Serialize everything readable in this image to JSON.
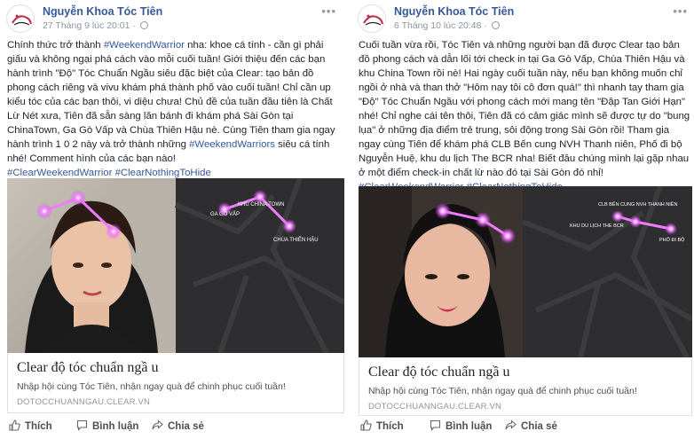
{
  "posts": [
    {
      "author": "Nguyễn Khoa Tóc Tiên",
      "timestamp": "27 Tháng 9 lúc 20:01 ·",
      "body_segments": [
        {
          "text": "Chính thức trở thành ",
          "tag": false
        },
        {
          "text": "#WeekendWarrior",
          "tag": true
        },
        {
          "text": " nha: khoe cá tính - cần gì phải giấu và không ngại phá cách vào mỗi cuối tuần! Giới thiệu đến các bạn hành trình \"Độ\" Tóc Chuẩn Ngầu siêu đặc biệt của Clear: tạo bản đồ phong cách riêng và vivu khám phá thành phố vào cuối tuần! Chỉ cần up kiểu tóc của các bạn thôi, vi diệu chưa! Chủ đề của tuần đầu tiên là Chất Lừ Nét xưa, Tiên đã sẵn sàng lăn bánh đi khám phá Sài Gòn tại ChinaTown, Ga Gò Vấp và Chùa Thiên Hậu nè. Cùng Tiên tham gia ngay hành trình 1 0 2 này và trở thành những ",
          "tag": false
        },
        {
          "text": "#WeekendWarriors",
          "tag": true
        },
        {
          "text": " siêu cá tính nhé! Comment hình của các bạn nào!",
          "tag": false
        },
        {
          "text": "\n",
          "tag": false
        },
        {
          "text": "#ClearWeekendWarrior",
          "tag": true
        },
        {
          "text": " ",
          "tag": false
        },
        {
          "text": "#ClearNothingToHide",
          "tag": true
        }
      ],
      "map_labels": [
        "GA GÒ VẤP",
        "KHU CHINA TOWN",
        "CHÙA THIÊN HẬU"
      ],
      "link_title": "Clear độ tóc chuẩn ngầ u",
      "link_desc": "Nhập hội cùng Tóc Tiên, nhận ngay quà để chinh phục cuối tuần!",
      "link_domain": "DOTOCCHUANNGAU.CLEAR.VN",
      "actions": [
        "Thích",
        "Bình luận",
        "Chia sẻ"
      ]
    },
    {
      "author": "Nguyễn Khoa Tóc Tiên",
      "timestamp": "6 Tháng 10 lúc 20:48 ·",
      "body_segments": [
        {
          "text": "Cuối tuần vừa rồi, Tóc Tiên và những người bạn đã được Clear tạo bản đồ phong cách và dẫn lối tới check in tại Ga Gò Vấp, Chùa Thiên Hậu và khu China Town rồi nè! Hai ngày cuối tuần này, nếu bạn không muốn chỉ ngồi ở nhà và than thở \"Hôm nay tôi cô đơn quá!\" thì nhanh tay tham gia \"Độ\" Tóc Chuẩn Ngầu với phong cách mới mang tên \"Đập Tan Giới Hạn\" nhé! Chỉ nghe cái tên thôi, Tiên đã có cảm giác mình sẽ được tự do \"bung lụa\" ở những địa điểm trẻ trung, sôi động trong Sài Gòn rồi! Tham gia ngay cùng Tiên để khám phá CLB Bến cung NVH Thanh niên, Phố đi bộ Nguyễn Huệ, khu du lịch The BCR nha! Biết đâu chúng mình lại gặp nhau ở một điểm check-in chất lừ nào đó tại Sài Gòn đó nhỉ!",
          "tag": false
        },
        {
          "text": "\n",
          "tag": false
        },
        {
          "text": "#ClearWeekendWarrior",
          "tag": true
        },
        {
          "text": " ",
          "tag": false
        },
        {
          "text": "#ClearNothingToHide",
          "tag": true
        }
      ],
      "map_labels": [
        "CLB BẾN CUNG NVH THANH NIÊN",
        "KHU DU LỊCH THE BCR",
        "PHỐ ĐI BỘ"
      ],
      "link_title": "Clear độ tóc chuẩn ngầ u",
      "link_desc": "Nhập hội cùng Tóc Tiên, nhận ngay quà để chinh phục cuối tuần!",
      "link_domain": "DOTOCCHUANNGAU.CLEAR.VN",
      "actions": [
        "Thích",
        "Bình luận",
        "Chia sẻ"
      ]
    }
  ],
  "colors": {
    "link_blue": "#365899",
    "meta_gray": "#90949c",
    "text": "#1d2129",
    "glow_pink": "#e040fb",
    "map_bg": "#2e2e30"
  },
  "icons": {
    "more": "more-dots-icon",
    "like": "thumbs-up-icon",
    "comment": "comment-bubble-icon",
    "share": "share-arrow-icon",
    "privacy": "globe-icon"
  }
}
